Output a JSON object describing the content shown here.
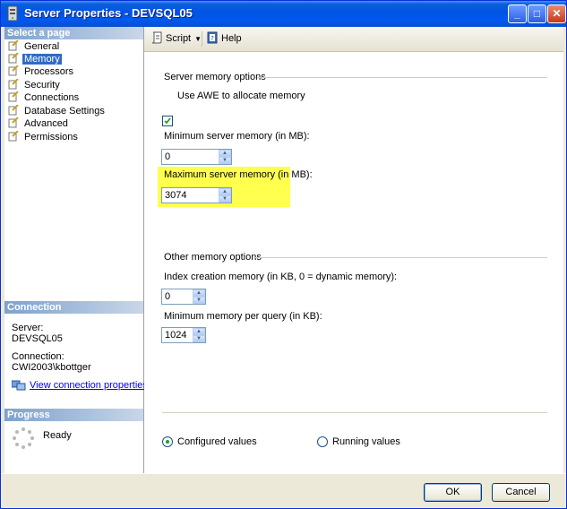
{
  "window": {
    "title": "Server Properties - DEVSQL05"
  },
  "title_buttons": {
    "minimize": "_",
    "maximize": "□",
    "close": "✕"
  },
  "left_panel": {
    "select_page_header": "Select a page",
    "pages": [
      {
        "label": "General",
        "icon": "page-wrench-icon",
        "selected": false
      },
      {
        "label": "Memory",
        "icon": "page-wrench-icon",
        "selected": true
      },
      {
        "label": "Processors",
        "icon": "page-wrench-icon",
        "selected": false
      },
      {
        "label": "Security",
        "icon": "page-wrench-icon",
        "selected": false
      },
      {
        "label": "Connections",
        "icon": "page-wrench-icon",
        "selected": false
      },
      {
        "label": "Database Settings",
        "icon": "page-wrench-icon",
        "selected": false
      },
      {
        "label": "Advanced",
        "icon": "page-wrench-icon",
        "selected": false
      },
      {
        "label": "Permissions",
        "icon": "page-wrench-icon",
        "selected": false
      }
    ],
    "connection_header": "Connection",
    "server_label": "Server:",
    "server_value": "DEVSQL05",
    "connection_label": "Connection:",
    "connection_value": "CWI2003\\kbottger",
    "view_props_link": "View connection properties",
    "progress_header": "Progress",
    "progress_status": "Ready"
  },
  "toolbar": {
    "script_label": "Script",
    "help_label": "Help"
  },
  "memory": {
    "server_group_label": "Server memory options",
    "awe_checkbox_label": "Use AWE to allocate memory",
    "awe_checked": true,
    "min_server_label": "Minimum server memory (in MB):",
    "min_server_value": "0",
    "max_server_label": "Maximum server memory (in MB):",
    "max_server_value": "3074",
    "other_group_label": "Other memory options",
    "index_mem_label": "Index creation memory (in KB, 0 = dynamic memory):",
    "index_mem_value": "0",
    "min_query_label": "Minimum memory per query (in KB):",
    "min_query_value": "1024"
  },
  "view_mode": {
    "configured_label": "Configured values",
    "running_label": "Running values",
    "selected": "configured"
  },
  "buttons": {
    "ok": "OK",
    "cancel": "Cancel"
  },
  "colors": {
    "highlight": "#ffff4d",
    "selection": "#316ac5",
    "titlebar": "#0054e3"
  }
}
